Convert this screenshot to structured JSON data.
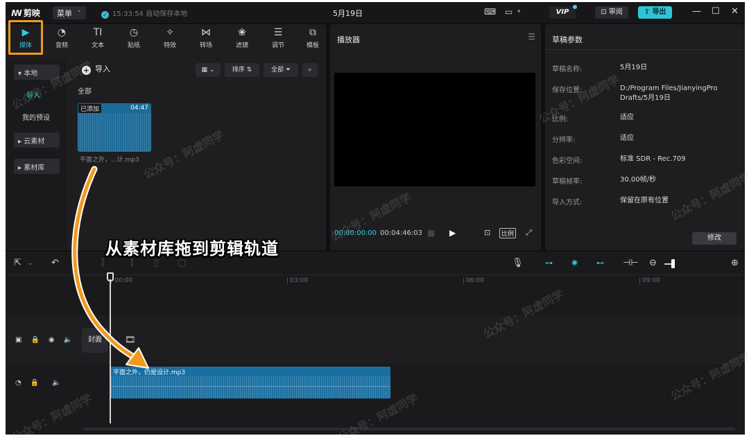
{
  "titlebar": {
    "app_name": "剪映",
    "menu_label": "菜单",
    "save_status": "15:33:54 自动保存本地",
    "doc_title": "5月19日",
    "vip_label": "VIP",
    "review_label": "审阅",
    "export_label": "导出"
  },
  "tools": [
    {
      "label": "媒体",
      "icon": "media-icon",
      "active": true
    },
    {
      "label": "音频",
      "icon": "audio-icon"
    },
    {
      "label": "文本",
      "icon": "text-icon",
      "glyph": "TI"
    },
    {
      "label": "贴纸",
      "icon": "sticker-icon"
    },
    {
      "label": "特效",
      "icon": "effects-icon"
    },
    {
      "label": "转场",
      "icon": "transition-icon"
    },
    {
      "label": "滤镜",
      "icon": "filter-icon"
    },
    {
      "label": "调节",
      "icon": "adjust-icon"
    },
    {
      "label": "模板",
      "icon": "template-icon"
    }
  ],
  "sidenav": {
    "local": "本地",
    "import": "导入",
    "my_presets": "我的预设",
    "cloud": "云素材",
    "library": "素材库"
  },
  "media": {
    "import_label": "导入",
    "sort_label": "排序",
    "all_filter_label": "全部",
    "section_label": "全部",
    "clip": {
      "status": "已添加",
      "duration": "04:47",
      "name": "平面之外，...计.mp3"
    }
  },
  "player": {
    "title": "播放器",
    "current_time": "00:00:00:00",
    "total_time": "00:04:46:03",
    "ratio_label": "比例"
  },
  "draft": {
    "title": "草稿参数",
    "params": [
      {
        "key": "草稿名称:",
        "value": "5月19日"
      },
      {
        "key": "保存位置:",
        "value": "D:/Program Files/JianyingPro Drafts/5月19日"
      },
      {
        "key": "比例:",
        "value": "适应"
      },
      {
        "key": "分辨率:",
        "value": "适应"
      },
      {
        "key": "色彩空间:",
        "value": "标准 SDR - Rec.709"
      },
      {
        "key": "草稿帧率:",
        "value": "30.00帧/秒"
      },
      {
        "key": "导入方式:",
        "value": "保留在原有位置"
      }
    ],
    "modify_label": "修改"
  },
  "annotation": {
    "callout": "从素材库拖到剪辑轨道",
    "arrow_color": "#f29a1f"
  },
  "timeline": {
    "ticks": [
      "00:00",
      "03:00",
      "06:00",
      "09:00"
    ],
    "cover_label": "封面",
    "audio_clip_name": "平面之外，仍是设计.mp3"
  },
  "watermark": "公众号：阿虚同学",
  "colors": {
    "accent": "#36c9dd",
    "highlight": "#f29a1f",
    "clip_blue": "#1a6fa1"
  }
}
